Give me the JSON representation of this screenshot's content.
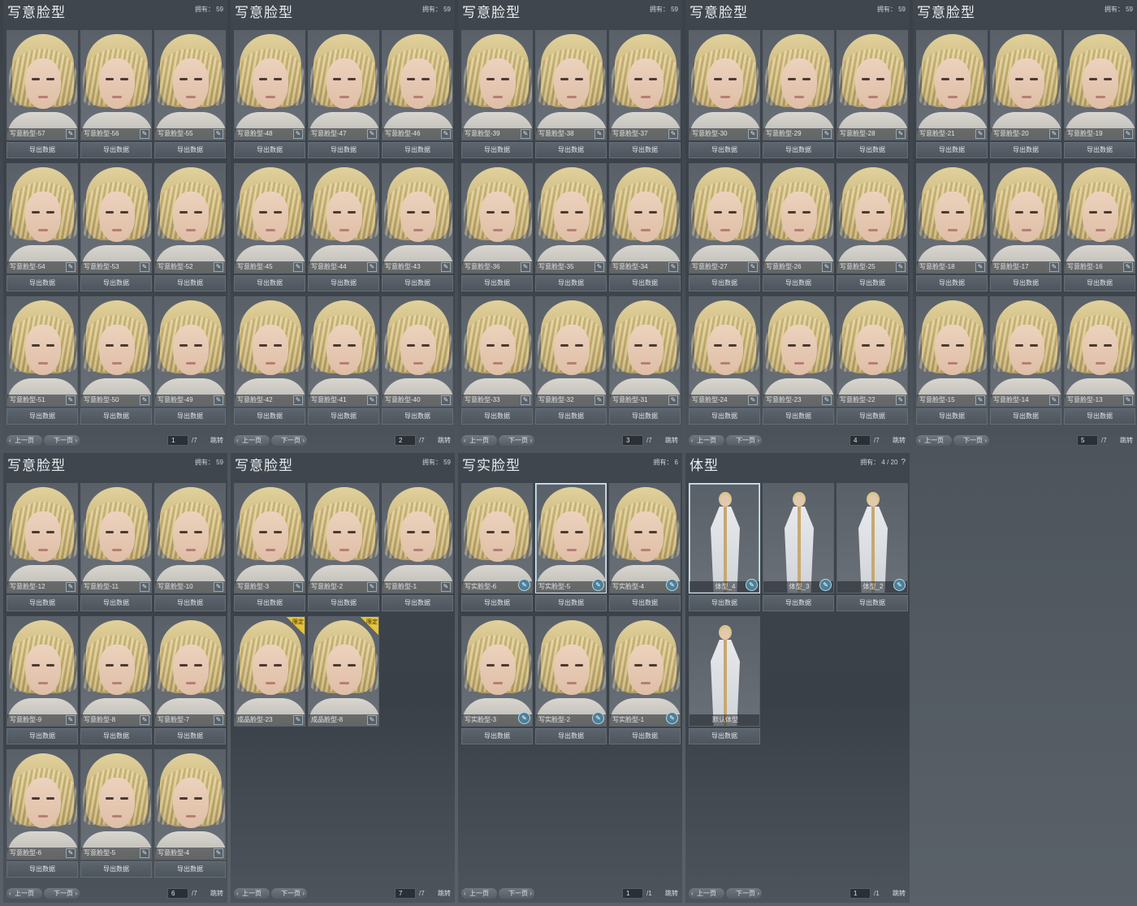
{
  "export_label": "导出数据",
  "pager": {
    "prev": "上一页",
    "next": "下一页",
    "jump": "跳转"
  },
  "panels": [
    {
      "title": "写意脸型",
      "owned": "拥有： 59",
      "page": "1",
      "total": "/7",
      "cards": [
        {
          "name": "写意脸型-57",
          "tone": "warm"
        },
        {
          "name": "写意脸型-56",
          "tone": "warm"
        },
        {
          "name": "写意脸型-55",
          "tone": "warm"
        },
        {
          "name": "写意脸型-54",
          "tone": "warm"
        },
        {
          "name": "写意脸型-53",
          "tone": "warm"
        },
        {
          "name": "写意脸型-52",
          "tone": "warm"
        },
        {
          "name": "写意脸型-51",
          "tone": "warm"
        },
        {
          "name": "写意脸型-50",
          "tone": "warm"
        },
        {
          "name": "写意脸型-49",
          "tone": "warm"
        }
      ]
    },
    {
      "title": "写意脸型",
      "owned": "拥有： 59",
      "page": "2",
      "total": "/7",
      "cards": [
        {
          "name": "写意脸型-48"
        },
        {
          "name": "写意脸型-47"
        },
        {
          "name": "写意脸型-46"
        },
        {
          "name": "写意脸型-45"
        },
        {
          "name": "写意脸型-44"
        },
        {
          "name": "写意脸型-43"
        },
        {
          "name": "写意脸型-42"
        },
        {
          "name": "写意脸型-41"
        },
        {
          "name": "写意脸型-40"
        }
      ]
    },
    {
      "title": "写意脸型",
      "owned": "拥有： 59",
      "page": "3",
      "total": "/7",
      "cards": [
        {
          "name": "写意脸型-39"
        },
        {
          "name": "写意脸型-38"
        },
        {
          "name": "写意脸型-37"
        },
        {
          "name": "写意脸型-36"
        },
        {
          "name": "写意脸型-35"
        },
        {
          "name": "写意脸型-34"
        },
        {
          "name": "写意脸型-33"
        },
        {
          "name": "写意脸型-32"
        },
        {
          "name": "写意脸型-31"
        }
      ]
    },
    {
      "title": "写意脸型",
      "owned": "拥有： 59",
      "page": "4",
      "total": "/7",
      "cards": [
        {
          "name": "写意脸型-30"
        },
        {
          "name": "写意脸型-29"
        },
        {
          "name": "写意脸型-28"
        },
        {
          "name": "写意脸型-27"
        },
        {
          "name": "写意脸型-26"
        },
        {
          "name": "写意脸型-25"
        },
        {
          "name": "写意脸型-24"
        },
        {
          "name": "写意脸型-23"
        },
        {
          "name": "写意脸型-22"
        }
      ]
    },
    {
      "title": "写意脸型",
      "owned": "拥有： 59",
      "page": "5",
      "total": "/7",
      "cards": [
        {
          "name": "写意脸型-21"
        },
        {
          "name": "写意脸型-20"
        },
        {
          "name": "写意脸型-19"
        },
        {
          "name": "写意脸型-18"
        },
        {
          "name": "写意脸型-17"
        },
        {
          "name": "写意脸型-16"
        },
        {
          "name": "写意脸型-15"
        },
        {
          "name": "写意脸型-14"
        },
        {
          "name": "写意脸型-13"
        }
      ]
    },
    {
      "title": "写意脸型",
      "owned": "拥有： 59",
      "page": "6",
      "total": "/7",
      "cards": [
        {
          "name": "写意脸型-12"
        },
        {
          "name": "写意脸型-11"
        },
        {
          "name": "写意脸型-10"
        },
        {
          "name": "写意脸型-9"
        },
        {
          "name": "写意脸型-8"
        },
        {
          "name": "写意脸型-7"
        },
        {
          "name": "写意脸型-6"
        },
        {
          "name": "写意脸型-5"
        },
        {
          "name": "写意脸型-4"
        }
      ]
    },
    {
      "title": "写意脸型",
      "owned": "拥有： 59",
      "page": "7",
      "total": "/7",
      "cards": [
        {
          "name": "写意脸型-3"
        },
        {
          "name": "写意脸型-2"
        },
        {
          "name": "写意脸型-1"
        },
        {
          "name": "成品脸型-23",
          "badge": "限定",
          "no_export": true
        },
        {
          "name": "成品脸型-8",
          "badge": "限定",
          "no_export": true
        }
      ]
    },
    {
      "title": "写实脸型",
      "owned": "拥有： 6",
      "page": "1",
      "total": "/1",
      "cards": [
        {
          "name": "写实脸型-6",
          "circle": true
        },
        {
          "name": "写实脸型-5",
          "circle": true,
          "selected": true
        },
        {
          "name": "写实脸型-4",
          "circle": true
        },
        {
          "name": "写实脸型-3",
          "circle": true
        },
        {
          "name": "写实脸型-2",
          "circle": true
        },
        {
          "name": "写实脸型-1",
          "circle": true
        }
      ]
    },
    {
      "title": "体型",
      "owned": "拥有： 4 / 20",
      "help": "?",
      "page": "1",
      "total": "/1",
      "body": true,
      "cards": [
        {
          "name": "体型_4",
          "circle": true,
          "selected": true
        },
        {
          "name": "体型_3",
          "circle": true
        },
        {
          "name": "体型_2",
          "circle": true
        },
        {
          "name": "默认体型"
        }
      ]
    }
  ],
  "icons": {
    "edit": "edit-icon",
    "prev_arrow": "‹",
    "next_arrow": "›"
  }
}
